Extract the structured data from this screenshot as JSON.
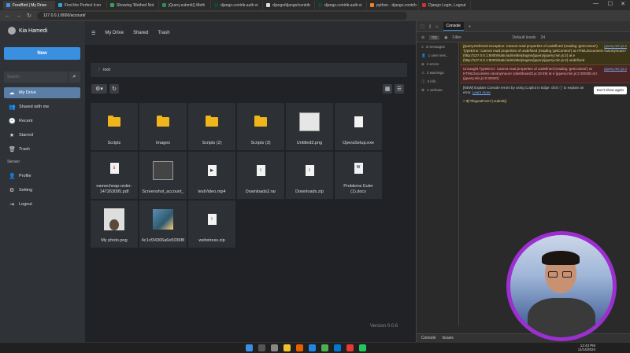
{
  "browser": {
    "tabs": [
      {
        "label": "FreeBird | My Drive",
        "color": "#4a90e2"
      },
      {
        "label": "Find the Perfect Icon",
        "color": "#2aa6de"
      },
      {
        "label": "Showing 'Method Not",
        "color": "#3aa05a"
      },
      {
        "label": "jQuery.submit() Meth",
        "color": "#2e8b57"
      },
      {
        "label": "django.contrib.auth.vi",
        "color": "#0c4b33"
      },
      {
        "label": "django/django/contrib",
        "color": "#ddd"
      },
      {
        "label": "django.contrib.auth.vi",
        "color": "#0c4b33"
      },
      {
        "label": "python - django.contrib",
        "color": "#f48024"
      },
      {
        "label": "Django Login, Logout",
        "color": "#cc3333"
      }
    ],
    "url": "127.0.0.1:8000/account/"
  },
  "sidebar": {
    "user_name": "Kia Hamedi",
    "new_button": "New",
    "search_placeholder": "Search",
    "nav": [
      {
        "label": "My Drive",
        "icon": "cloud-icon",
        "glyph": "☁"
      },
      {
        "label": "Shared with me",
        "icon": "users-icon",
        "glyph": "👥"
      },
      {
        "label": "Recent",
        "icon": "clock-icon",
        "glyph": "🕘"
      },
      {
        "label": "Starred",
        "icon": "star-icon",
        "glyph": "★"
      },
      {
        "label": "Trash",
        "icon": "trash-icon",
        "glyph": "🗑"
      }
    ],
    "server_label": "Server",
    "server_nav": [
      {
        "label": "Profile",
        "icon": "user-icon",
        "glyph": "👤"
      },
      {
        "label": "Setting",
        "icon": "gear-icon",
        "glyph": "⚙"
      },
      {
        "label": "Logout",
        "icon": "logout-icon",
        "glyph": "⇥"
      }
    ]
  },
  "topbar": {
    "menu_glyph": "☰",
    "links": [
      "My Drive",
      "Shared",
      "Trash"
    ]
  },
  "breadcrumb": {
    "sep": "/",
    "current": "root"
  },
  "files": [
    {
      "name": "Scripts",
      "kind": "folder"
    },
    {
      "name": "Images",
      "kind": "folder"
    },
    {
      "name": "Scripts (2)",
      "kind": "folder"
    },
    {
      "name": "Scripts (3)",
      "kind": "folder"
    },
    {
      "name": "Untitled3.png",
      "kind": "image"
    },
    {
      "name": "OperaSetup.exe",
      "kind": "file"
    },
    {
      "name": "namecheap-order-147263095.pdf",
      "kind": "pdf"
    },
    {
      "name": "Screenshot_account_",
      "kind": "screenshot"
    },
    {
      "name": "testVideo.mp4",
      "kind": "video"
    },
    {
      "name": "Downloads2.rar",
      "kind": "archive"
    },
    {
      "name": "Downloads.zip",
      "kind": "archive"
    },
    {
      "name": "Problems Euler (1).docx",
      "kind": "word"
    },
    {
      "name": "My photo.png",
      "kind": "photo"
    },
    {
      "name": "4c1cf34306a6e5036f8",
      "kind": "bluephoto"
    },
    {
      "name": "webstress.zip",
      "kind": "archive"
    }
  ],
  "version": "Version 0.0.6",
  "devtools": {
    "tabs": [
      "Console"
    ],
    "context": "top",
    "filter_placeholder": "Filter",
    "levels": "Default levels",
    "count": "34",
    "sidebar": [
      "3 messages",
      "1 user mes...",
      "2 errors",
      "2 warnings",
      "3 info",
      "1 verbose"
    ],
    "warning": {
      "text": "jQuery.Deferred exception: Cannot read properties of undefined (reading 'getContext') TypeError: Cannot read properties of undefined (reading 'getContext') at HTMLDocument.<anonymous> (http://127.0.0.1:8000/static/adminlte/plugins/jquery/jquery.min.js:2) at e (http://127.0.0.1:8000/static/adminlte/plugins/jquery/jquery.min.js:2) undefined",
      "source": "jquery.min.js:2"
    },
    "error": {
      "text": "Uncaught TypeError: Cannot read properties of undefined (reading 'getContext') at HTMLDocument.<anonymous> (dashboard2.js:18:49) at e (jquery.min.js:2:30039) at t (jquery.min.js:2:30340)",
      "source": "jquery.min.js:2"
    },
    "copilot": {
      "text": "[NEW] Explain Console errors by using Copilot in Edge: click ⓘ to explain an error.",
      "link": "Learn more",
      "button": "Don't show again"
    },
    "prompt": "$(\"#logoutForm\").submit()",
    "bottom": [
      "Console",
      "Issues"
    ]
  },
  "taskbar": {
    "time": "12:43 PM",
    "date": "11/14/2024"
  }
}
